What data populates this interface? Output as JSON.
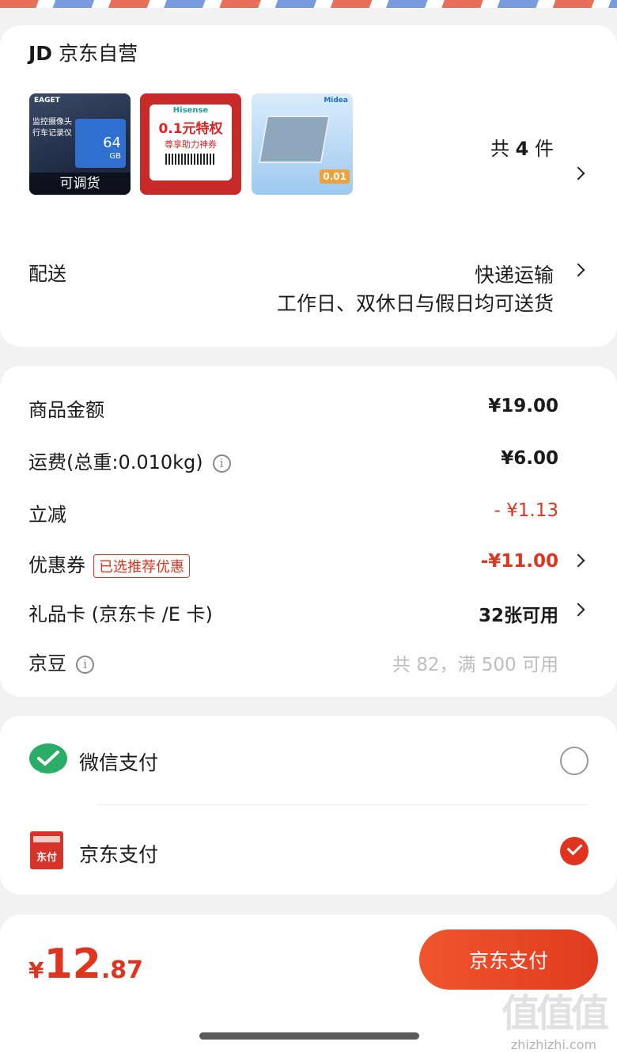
{
  "store": {
    "logo": "JD",
    "name": "京东自营",
    "thumbnails": [
      {
        "brand": "EAGET",
        "lines": [
          "监控摄像头",
          "行车记录仪"
        ],
        "capacity": "64",
        "unit": "GB",
        "overlay": "可调货"
      },
      {
        "brand": "Hisense",
        "headline": "0.1元特权",
        "sub": "尊享助力神券"
      },
      {
        "brand": "Midea",
        "price_tag": "0.01"
      }
    ],
    "count_prefix": "共",
    "count": "4",
    "count_suffix": "件"
  },
  "delivery": {
    "label": "配送",
    "method": "快递运输",
    "note": "工作日、双休日与假日均可送货"
  },
  "amounts": {
    "goods": {
      "label": "商品金额",
      "value": "¥19.00"
    },
    "shipping": {
      "label": "运费(总重:0.010kg)",
      "value": "¥6.00"
    },
    "discount": {
      "label": "立减",
      "value": "- ¥1.13"
    },
    "coupon": {
      "label": "优惠券",
      "badge": "已选推荐优惠",
      "value": "-¥11.00"
    },
    "giftcard": {
      "label": "礼品卡 (京东卡 /E 卡)",
      "value": "32张可用"
    },
    "jingdou": {
      "label": "京豆",
      "value": "共 82，满 500 可用"
    }
  },
  "payment": {
    "options": [
      {
        "label": "微信支付",
        "selected": false,
        "icon": "wechat-pay-icon"
      },
      {
        "label": "京东支付",
        "selected": true,
        "icon": "jd-pay-icon",
        "icon_text": "东付"
      }
    ]
  },
  "footer": {
    "currency": "¥",
    "total_int": "12",
    "total_dec": ".87",
    "pay_button": "京东支付"
  },
  "watermark": {
    "big": "值值值",
    "small": "zhizhizhi.com"
  },
  "colors": {
    "accent": "#e0341e",
    "wechat": "#2aae67",
    "jdpay": "#d6332a"
  }
}
